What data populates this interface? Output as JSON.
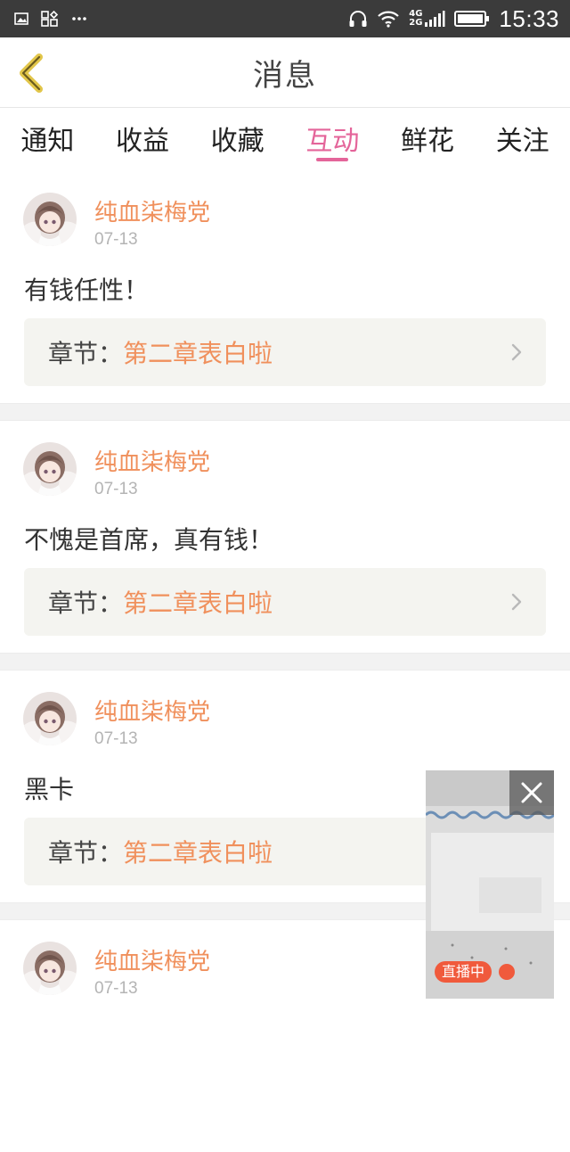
{
  "status_bar": {
    "network_label_top": "4G",
    "network_label_bottom": "2G",
    "time": "15:33",
    "icons": [
      "image-icon",
      "apps-icon",
      "more-icon",
      "headphones-icon",
      "wifi-icon",
      "signal-icon",
      "battery-icon"
    ]
  },
  "header": {
    "title": "消息"
  },
  "tabs": [
    {
      "label": "通知",
      "active": false
    },
    {
      "label": "收益",
      "active": false
    },
    {
      "label": "收藏",
      "active": false
    },
    {
      "label": "互动",
      "active": true
    },
    {
      "label": "鲜花",
      "active": false
    },
    {
      "label": "关注",
      "active": false
    }
  ],
  "messages": [
    {
      "user": "纯血柒梅党",
      "date": "07-13",
      "content": "有钱任性！",
      "chapter_label": "章节：",
      "chapter_title": "第二章表白啦"
    },
    {
      "user": "纯血柒梅党",
      "date": "07-13",
      "content": "不愧是首席，真有钱！",
      "chapter_label": "章节：",
      "chapter_title": "第二章表白啦"
    },
    {
      "user": "纯血柒梅党",
      "date": "07-13",
      "content": "黑卡",
      "chapter_label": "章节：",
      "chapter_title": "第二章表白啦"
    },
    {
      "user": "纯血柒梅党",
      "date": "07-13"
    }
  ],
  "live_widget": {
    "badge": "直播中"
  },
  "colors": {
    "accent_pink": "#e4659a",
    "accent_orange": "#f0905c",
    "status_bar": "#3b3b3b"
  }
}
